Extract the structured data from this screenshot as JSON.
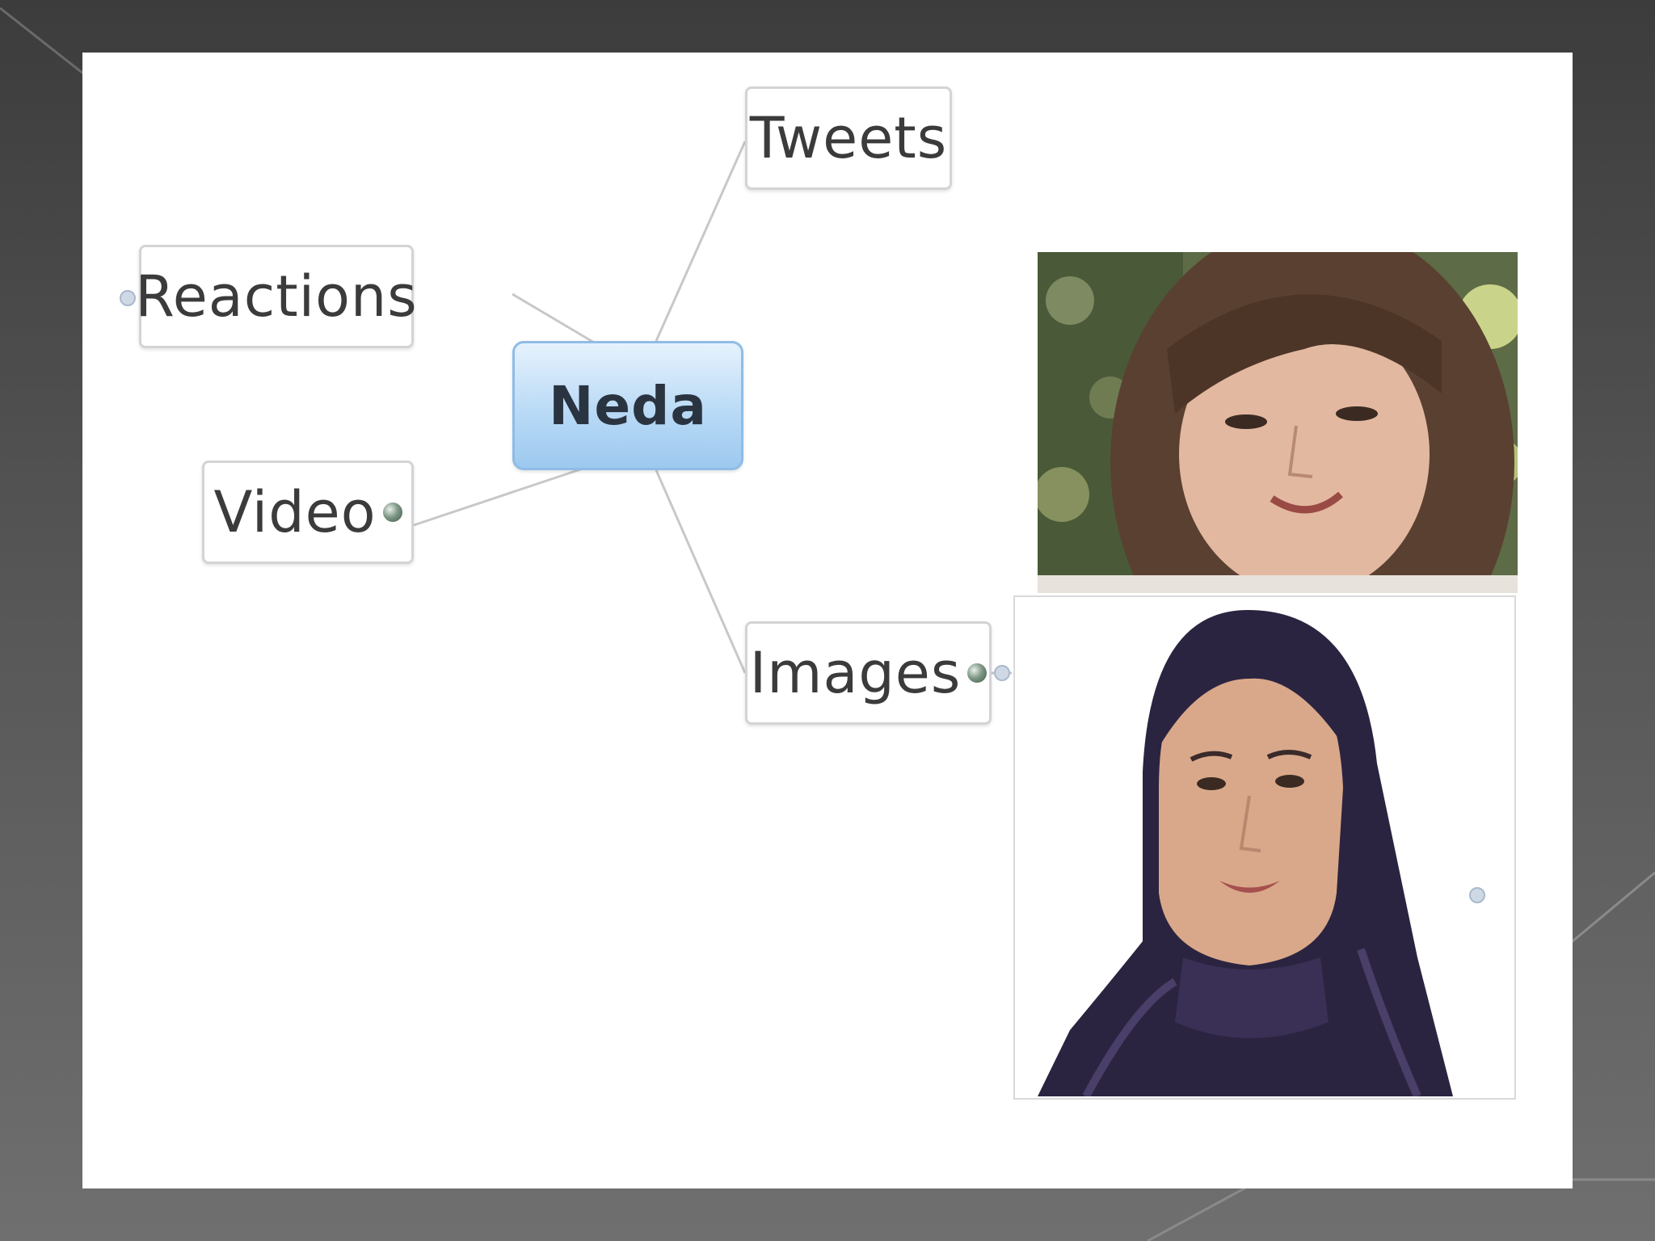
{
  "central_topic": "Neda",
  "branches": {
    "tweets": "Tweets",
    "reactions": "Reactions",
    "video": "Video",
    "images": "Images"
  },
  "images": [
    {
      "icon": "portrait-photo-icon",
      "description": "woman with bangs"
    },
    {
      "icon": "portrait-photo-icon",
      "description": "woman in dark headscarf"
    }
  ],
  "colors": {
    "central_fill": "#b9daf6",
    "node_border": "#d4d4d4",
    "connector": "#c8c8c8",
    "background": "#555555"
  }
}
